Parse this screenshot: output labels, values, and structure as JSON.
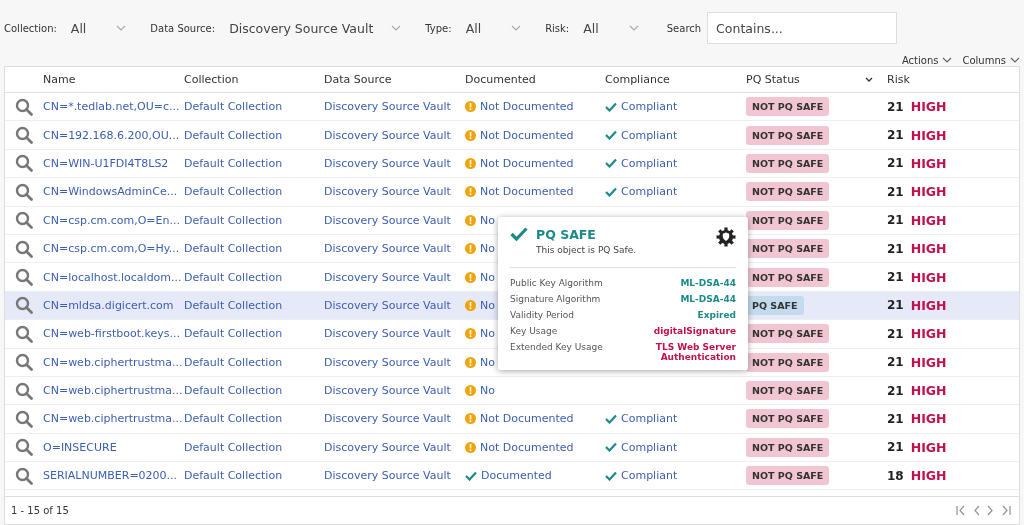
{
  "filters": [
    {
      "label": "Collection:",
      "value": "All"
    },
    {
      "label": "Data Source:",
      "value": "Discovery Source Vault"
    },
    {
      "label": "Type:",
      "value": "All"
    },
    {
      "label": "Risk:",
      "value": "All"
    }
  ],
  "search": {
    "label": "Search",
    "placeholder": "Contains..."
  },
  "table_menus": [
    "Actions",
    "Columns"
  ],
  "table": {
    "columns": [
      {
        "label": "Name",
        "sortable": false
      },
      {
        "label": "Collection",
        "sortable": false
      },
      {
        "label": "Data Source",
        "sortable": false
      },
      {
        "label": "Documented",
        "sortable": false
      },
      {
        "label": "Compliance",
        "sortable": false
      },
      {
        "label": "PQ Status",
        "sortable": true
      },
      {
        "label": "Risk",
        "sortable": false
      }
    ],
    "rows": [
      {
        "name": "CN=*.tedlab.net,OU=c...",
        "collection": "Default Collection",
        "data_source": "Discovery Source Vault",
        "documented": {
          "kind": "warning",
          "text": "Not Documented"
        },
        "compliance": "Compliant",
        "pq_status": {
          "text": "NOT PQ SAFE",
          "safe": false
        },
        "risk_score": "21",
        "risk_level": "HIGH",
        "selected": false
      },
      {
        "name": "CN=192.168.6.200,OU...",
        "collection": "Default Collection",
        "data_source": "Discovery Source Vault",
        "documented": {
          "kind": "warning",
          "text": "Not Documented"
        },
        "compliance": "Compliant",
        "pq_status": {
          "text": "NOT PQ SAFE",
          "safe": false
        },
        "risk_score": "21",
        "risk_level": "HIGH",
        "selected": false
      },
      {
        "name": "CN=WIN-U1FDI4T8LS2",
        "collection": "Default Collection",
        "data_source": "Discovery Source Vault",
        "documented": {
          "kind": "warning",
          "text": "Not Documented"
        },
        "compliance": "Compliant",
        "pq_status": {
          "text": "NOT PQ SAFE",
          "safe": false
        },
        "risk_score": "21",
        "risk_level": "HIGH",
        "selected": false
      },
      {
        "name": "CN=WindowsAdminCe...",
        "collection": "Default Collection",
        "data_source": "Discovery Source Vault",
        "documented": {
          "kind": "warning",
          "text": "Not Documented"
        },
        "compliance": "Compliant",
        "pq_status": {
          "text": "NOT PQ SAFE",
          "safe": false
        },
        "risk_score": "21",
        "risk_level": "HIGH",
        "selected": false
      },
      {
        "name": "CN=csp.cm.com,O=En...",
        "collection": "Default Collection",
        "data_source": "Discovery Source Vault",
        "documented": {
          "kind": "warning",
          "text": "No"
        },
        "pq_status": {
          "text": "NOT PQ SAFE",
          "safe": false
        },
        "risk_score": "21",
        "risk_level": "HIGH",
        "selected": false
      },
      {
        "name": "CN=csp.cm.com,O=Hy...",
        "collection": "Default Collection",
        "data_source": "Discovery Source Vault",
        "documented": {
          "kind": "warning",
          "text": "No"
        },
        "pq_status": {
          "text": "NOT PQ SAFE",
          "safe": false
        },
        "risk_score": "21",
        "risk_level": "HIGH",
        "selected": false
      },
      {
        "name": "CN=localhost.localdom...",
        "collection": "Default Collection",
        "data_source": "Discovery Source Vault",
        "documented": {
          "kind": "warning",
          "text": "No"
        },
        "pq_status": {
          "text": "NOT PQ SAFE",
          "safe": false
        },
        "risk_score": "21",
        "risk_level": "HIGH",
        "selected": false
      },
      {
        "name": "CN=mldsa.digicert.com",
        "collection": "Default Collection",
        "data_source": "Discovery Source Vault",
        "documented": {
          "kind": "warning",
          "text": "No"
        },
        "pq_status": {
          "text": "PQ SAFE",
          "safe": true
        },
        "risk_score": "21",
        "risk_level": "HIGH",
        "selected": true
      },
      {
        "name": "CN=web-firstboot.keys...",
        "collection": "Default Collection",
        "data_source": "Discovery Source Vault",
        "documented": {
          "kind": "warning",
          "text": "No"
        },
        "pq_status": {
          "text": "NOT PQ SAFE",
          "safe": false
        },
        "risk_score": "21",
        "risk_level": "HIGH",
        "selected": false
      },
      {
        "name": "CN=web.ciphertrustma...",
        "collection": "Default Collection",
        "data_source": "Discovery Source Vault",
        "documented": {
          "kind": "warning",
          "text": "No"
        },
        "pq_status": {
          "text": "NOT PQ SAFE",
          "safe": false
        },
        "risk_score": "21",
        "risk_level": "HIGH",
        "selected": false
      },
      {
        "name": "CN=web.ciphertrustma...",
        "collection": "Default Collection",
        "data_source": "Discovery Source Vault",
        "documented": {
          "kind": "warning",
          "text": "No"
        },
        "pq_status": {
          "text": "NOT PQ SAFE",
          "safe": false
        },
        "risk_score": "21",
        "risk_level": "HIGH",
        "selected": false
      },
      {
        "name": "CN=web.ciphertrustma...",
        "collection": "Default Collection",
        "data_source": "Discovery Source Vault",
        "documented": {
          "kind": "warning",
          "text": "Not Documented"
        },
        "compliance": "Compliant",
        "pq_status": {
          "text": "NOT PQ SAFE",
          "safe": false
        },
        "risk_score": "21",
        "risk_level": "HIGH",
        "selected": false
      },
      {
        "name": "O=INSECURE",
        "collection": "Default Collection",
        "data_source": "Discovery Source Vault",
        "documented": {
          "kind": "warning",
          "text": "Not Documented"
        },
        "compliance": "Compliant",
        "pq_status": {
          "text": "NOT PQ SAFE",
          "safe": false
        },
        "risk_score": "21",
        "risk_level": "HIGH",
        "selected": false
      },
      {
        "name": "SERIALNUMBER=0200...",
        "collection": "Default Collection",
        "data_source": "Discovery Source Vault",
        "documented": {
          "kind": "check",
          "text": "Documented"
        },
        "compliance": "Compliant",
        "pq_status": {
          "text": "NOT PQ SAFE",
          "safe": false
        },
        "risk_score": "18",
        "risk_level": "HIGH",
        "selected": false
      }
    ]
  },
  "popover": {
    "title": "PQ SAFE",
    "subtitle": "This object is PQ Safe.",
    "properties": [
      {
        "label": "Public Key Algorithm",
        "value": "ML-DSA-44",
        "color": "#1c8a8a"
      },
      {
        "label": "Signature Algorithm",
        "value": "ML-DSA-44",
        "color": "#1c8a8a"
      },
      {
        "label": "Validity Period",
        "value": "Expired",
        "color": "#1c8a8a"
      },
      {
        "label": "Key Usage",
        "value": "digitalSignature",
        "color": "#c0114e"
      },
      {
        "label": "Extended Key Usage",
        "value": "TLS Web Server Authentication",
        "color": "#c0114e"
      }
    ]
  },
  "pagination": {
    "summary": "1 - 15 of 15"
  }
}
